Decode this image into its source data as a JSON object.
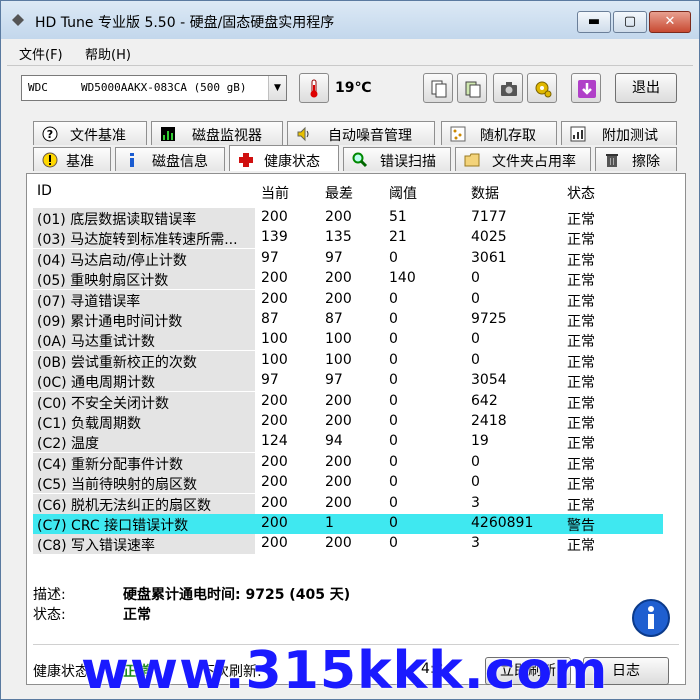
{
  "window": {
    "title": "HD Tune 专业版 5.50 - 硬盘/固态硬盘实用程序"
  },
  "menu": [
    "文件(F)",
    "帮助(H)"
  ],
  "drive": {
    "selected": "WDC     WD5000AAKX-083CA (500 gB)",
    "temperature": "19℃"
  },
  "toolbar": {
    "exit_label": "退出"
  },
  "tabs_row1": [
    "文件基准",
    "磁盘监视器",
    "自动噪音管理",
    "随机存取",
    "附加测试"
  ],
  "tabs_row2": [
    "基准",
    "磁盘信息",
    "健康状态",
    "错误扫描",
    "文件夹占用率",
    "擦除"
  ],
  "active_tab": "健康状态",
  "table": {
    "headers": [
      "ID",
      "当前",
      "最差",
      "阈值",
      "数据",
      "状态"
    ],
    "rows": [
      [
        "(01) 底层数据读取错误率",
        "200",
        "200",
        "51",
        "7177",
        "正常"
      ],
      [
        "(03) 马达旋转到标准转速所需...",
        "139",
        "135",
        "21",
        "4025",
        "正常"
      ],
      [
        "(04) 马达启动/停止计数",
        "97",
        "97",
        "0",
        "3061",
        "正常"
      ],
      [
        "(05) 重映射扇区计数",
        "200",
        "200",
        "140",
        "0",
        "正常"
      ],
      [
        "(07) 寻道错误率",
        "200",
        "200",
        "0",
        "0",
        "正常"
      ],
      [
        "(09) 累计通电时间计数",
        "87",
        "87",
        "0",
        "9725",
        "正常"
      ],
      [
        "(0A) 马达重试计数",
        "100",
        "100",
        "0",
        "0",
        "正常"
      ],
      [
        "(0B) 尝试重新校正的次数",
        "100",
        "100",
        "0",
        "0",
        "正常"
      ],
      [
        "(0C) 通电周期计数",
        "97",
        "97",
        "0",
        "3054",
        "正常"
      ],
      [
        "(C0) 不安全关闭计数",
        "200",
        "200",
        "0",
        "642",
        "正常"
      ],
      [
        "(C1) 负载周期数",
        "200",
        "200",
        "0",
        "2418",
        "正常"
      ],
      [
        "(C2) 温度",
        "124",
        "94",
        "0",
        "19",
        "正常"
      ],
      [
        "(C4) 重新分配事件计数",
        "200",
        "200",
        "0",
        "0",
        "正常"
      ],
      [
        "(C5) 当前待映射的扇区数",
        "200",
        "200",
        "0",
        "0",
        "正常"
      ],
      [
        "(C6) 脱机无法纠正的扇区数",
        "200",
        "200",
        "0",
        "3",
        "正常"
      ],
      [
        "(C7) CRC 接口错误计数",
        "200",
        "1",
        "0",
        "4260891",
        "警告"
      ],
      [
        "(C8) 写入错误速率",
        "200",
        "200",
        "0",
        "3",
        "正常"
      ]
    ],
    "highlight_row": 15,
    "highlight_color": "#3fe8f0"
  },
  "detail": {
    "desc_label": "描述:",
    "desc_value": "硬盘累计通电时间: 9725 (405 天)",
    "status_label": "状态:",
    "status_value": "正常"
  },
  "footer": {
    "health_label": "健康状态:",
    "health_value": "正常",
    "refresh_label": "下次刷新:",
    "refresh_value": "4:3",
    "refresh_button": "立即刷新",
    "log_button": "日志"
  },
  "watermark": "www.315kkk.com"
}
